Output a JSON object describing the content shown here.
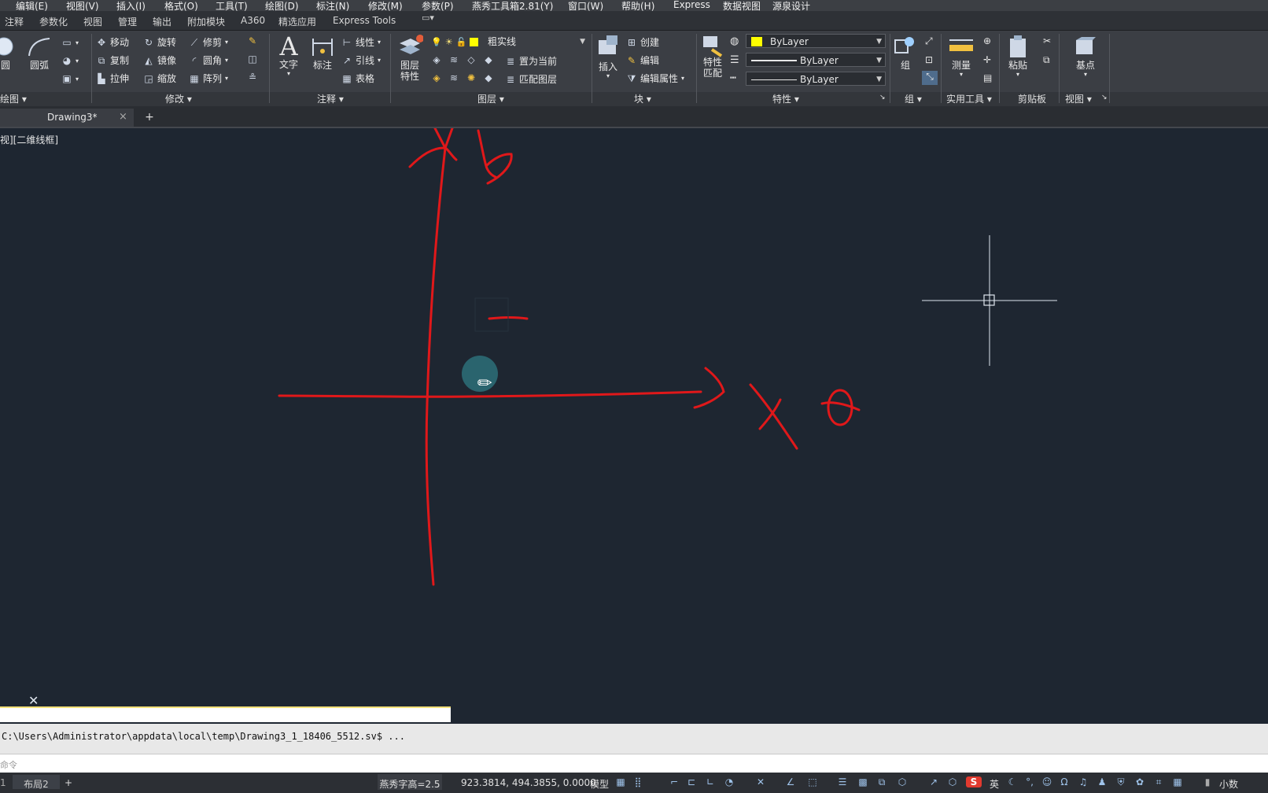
{
  "menu": [
    "编辑(E)",
    "视图(V)",
    "插入(I)",
    "格式(O)",
    "工具(T)",
    "绘图(D)",
    "标注(N)",
    "修改(M)",
    "参数(P)",
    "燕秀工具箱2.81(Y)",
    "窗口(W)",
    "帮助(H)",
    "Express",
    "数据视图",
    "源泉设计"
  ],
  "ribbon_tabs": [
    "注释",
    "参数化",
    "视图",
    "管理",
    "输出",
    "附加模块",
    "A360",
    "精选应用",
    "Express Tools"
  ],
  "draw_panel": {
    "circle": "圆",
    "arc": "圆弧",
    "title": "绘图"
  },
  "modify_panel": {
    "move": "移动",
    "rotate": "旋转",
    "trim": "修剪",
    "copy": "复制",
    "mirror": "镜像",
    "fillet": "圆角",
    "stretch": "拉伸",
    "scale": "缩放",
    "array": "阵列",
    "title": "修改"
  },
  "annotation_panel": {
    "text": "文字",
    "dimension": "标注",
    "linear": "线性",
    "leader": "引线",
    "table": "表格",
    "title": "注释"
  },
  "layer_panel": {
    "layer_props_1": "图层",
    "layer_props_2": "特性",
    "current_layer": "粗实线",
    "set_current": "置为当前",
    "match_layer": "匹配图层",
    "title": "图层"
  },
  "block_panel": {
    "insert": "插入",
    "create": "创建",
    "edit": "编辑",
    "edit_attr": "编辑属性",
    "title": "块"
  },
  "properties_panel": {
    "match_1": "特性",
    "match_2": "匹配",
    "color": "ByLayer",
    "linetype": "ByLayer",
    "lineweight": "ByLayer",
    "title": "特性"
  },
  "group_panel": {
    "group": "组",
    "title": "组"
  },
  "utilities_panel": {
    "measure": "测量",
    "title": "实用工具"
  },
  "clipboard_panel": {
    "paste": "粘贴",
    "title": "剪贴板"
  },
  "view_panel": {
    "base_point": "基点",
    "title": "视图"
  },
  "doc_tab": {
    "name": "Drawing3*",
    "close": "×",
    "add": "+"
  },
  "viewport_label": "视][二维线框]",
  "annotations": {
    "y_label": "y",
    "x_label": "x",
    "theta_label": "θ",
    "dash_label": "-"
  },
  "command": {
    "history": "C:\\Users\\Administrator\\appdata\\local\\temp\\Drawing3_1_18406_5512.sv$ ...",
    "prompt": "命令"
  },
  "status": {
    "layout_tab": "布局2",
    "add": "+",
    "text_height": "燕秀字高=2.5",
    "coords": "923.3814, 494.3855, 0.0000",
    "model": "模型",
    "ime_lang": "英",
    "decimal": "小数"
  },
  "colors": {
    "canvas": "#1e2631",
    "sketch": "#e0181a",
    "accent": "#f4e07a"
  }
}
